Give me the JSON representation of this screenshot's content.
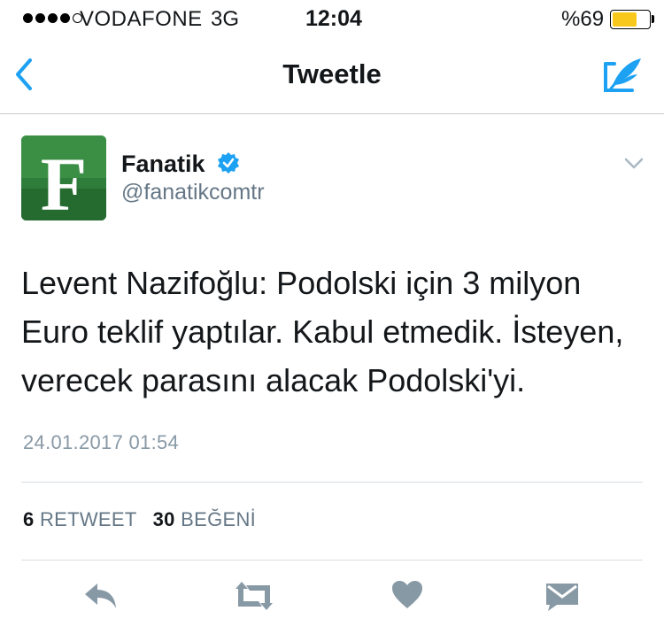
{
  "status_bar": {
    "carrier": "VODAFONE",
    "network": "3G",
    "time": "12:04",
    "battery": "%69",
    "battery_level": 0.69,
    "signal_bars_filled": 4,
    "signal_bars_total": 5
  },
  "nav": {
    "title": "Tweetle",
    "accent_color": "#1da1f2"
  },
  "tweet": {
    "author_name": "Fanatik",
    "author_handle": "@fanatikcomtr",
    "avatar_letter": "F",
    "verified": true,
    "text": "Levent Nazifoğlu: Podolski için 3 milyon Euro teklif yaptılar. Kabul etmedik. İsteyen, verecek parasını alacak Podolski'yi.",
    "timestamp": "24.01.2017 01:54",
    "retweet_count": "6",
    "retweet_label": "RETWEET",
    "like_count": "30",
    "like_label": "BEĞENİ"
  },
  "actions": {
    "icon_color": "#8899a6",
    "items": [
      "reply-icon",
      "retweet-icon",
      "like-icon",
      "direct-message-icon"
    ]
  }
}
